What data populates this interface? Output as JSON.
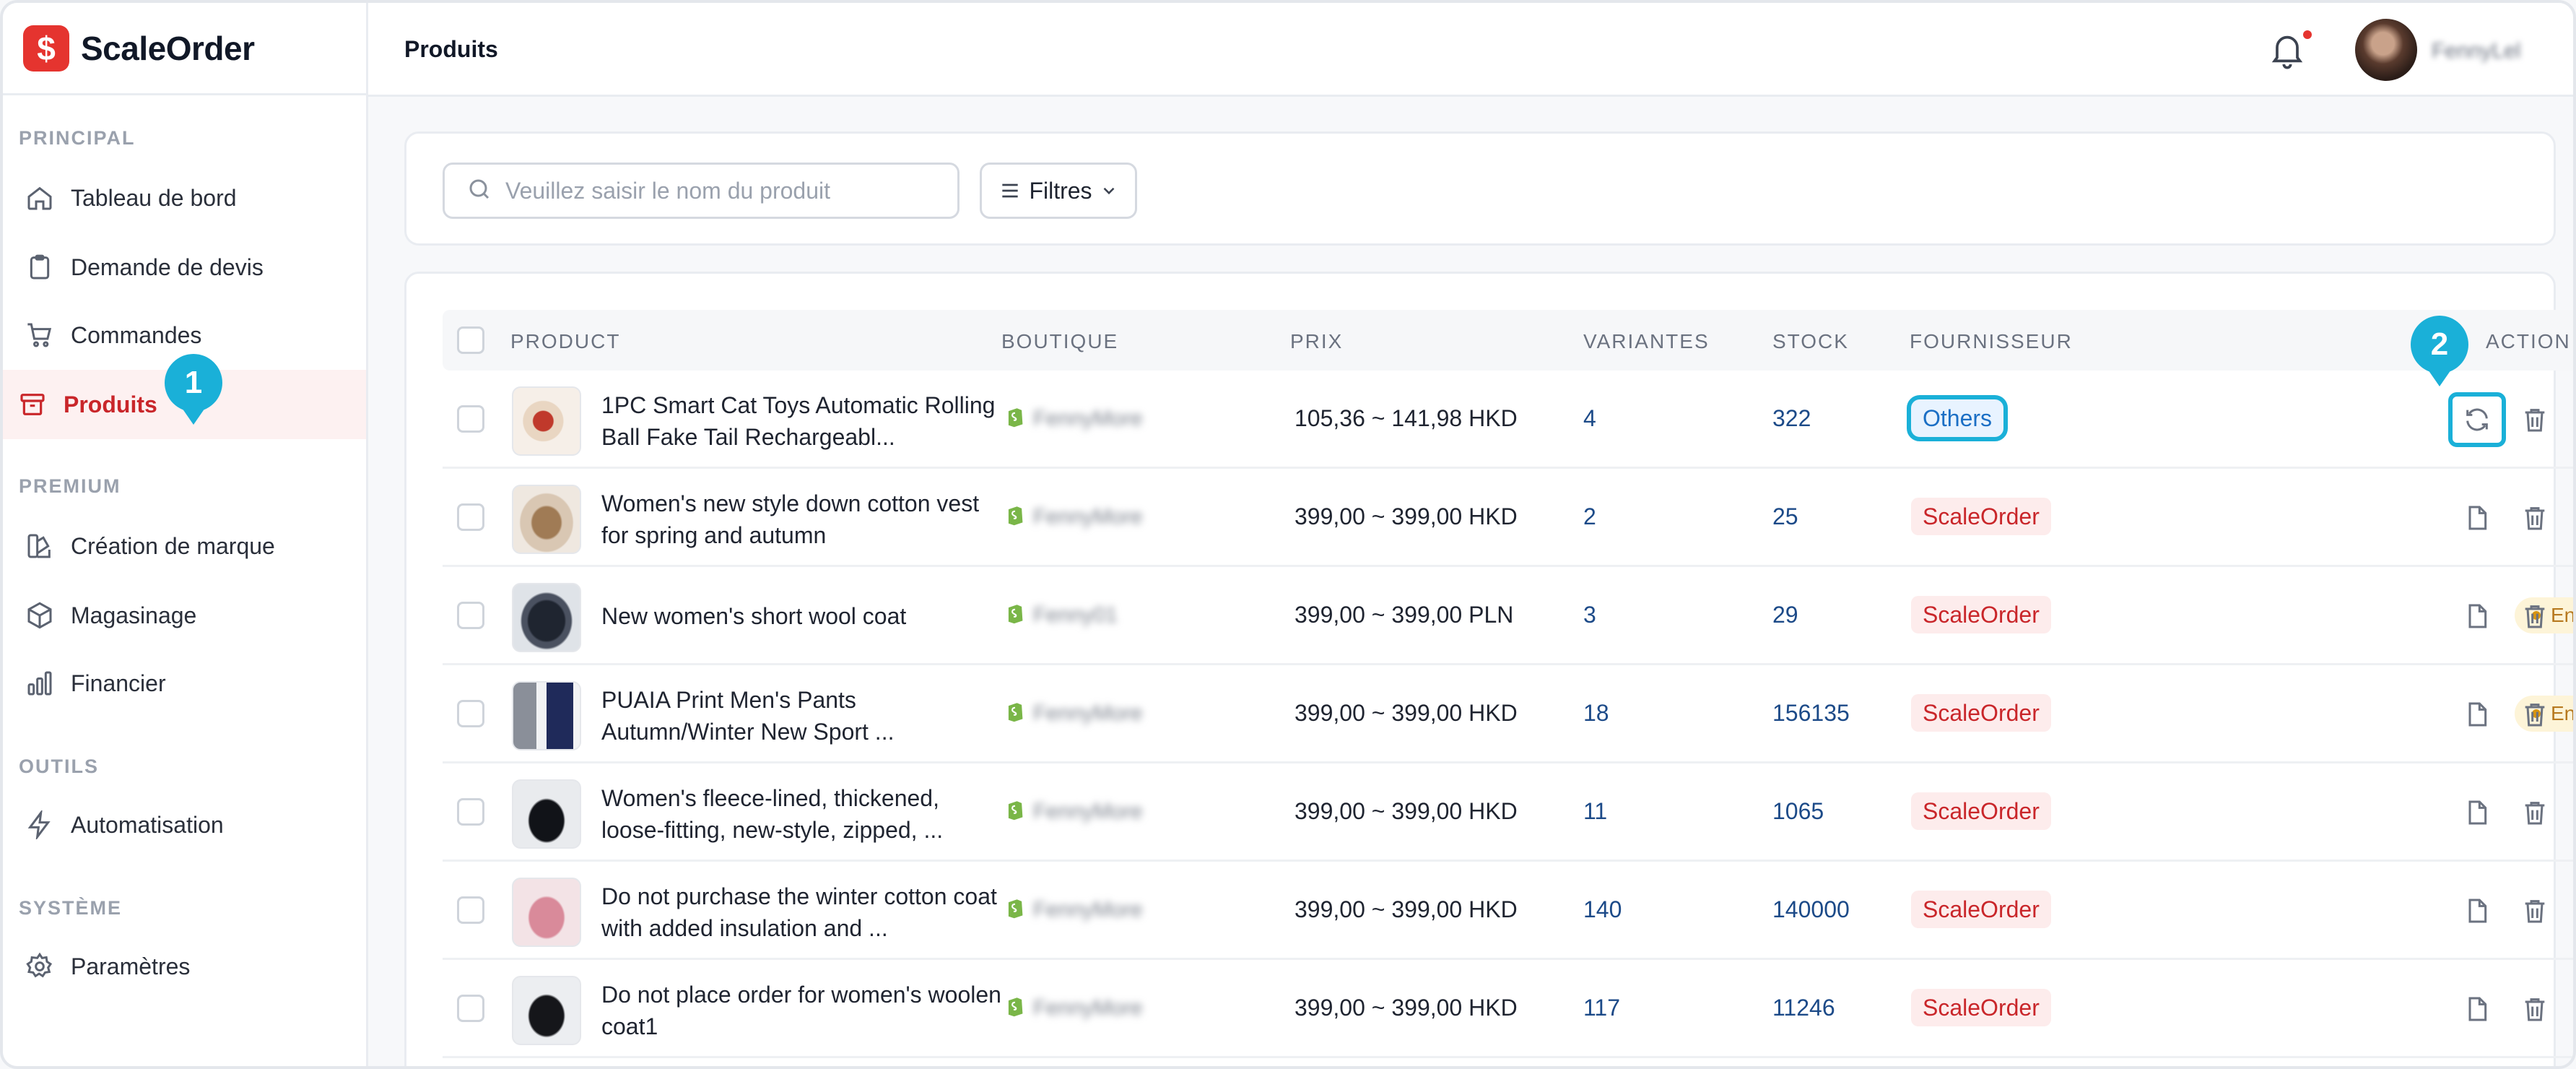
{
  "app": {
    "name": "ScaleOrder",
    "logo_glyph": "$"
  },
  "header": {
    "title": "Produits",
    "username": "FennyLel"
  },
  "sidebar": {
    "sections": [
      {
        "title": "PRINCIPAL",
        "items": [
          "Tableau de bord",
          "Demande de devis",
          "Commandes",
          "Produits"
        ]
      },
      {
        "title": "PREMIUM",
        "items": [
          "Création de marque",
          "Magasinage",
          "Financier"
        ]
      },
      {
        "title": "OUTILS",
        "items": [
          "Automatisation"
        ]
      },
      {
        "title": "SYSTÈME",
        "items": [
          "Paramètres"
        ]
      }
    ],
    "active": "Produits"
  },
  "steps": {
    "one": "1",
    "two": "2"
  },
  "search": {
    "placeholder": "Veuillez saisir le nom du produit",
    "filter_label": "Filtres"
  },
  "table": {
    "headers": {
      "product": "PRODUCT",
      "boutique": "BOUTIQUE",
      "prix": "PRIX",
      "variantes": "VARIANTES",
      "stock": "STOCK",
      "fournisseur": "FOURNISSEUR",
      "action": "ACTION"
    },
    "rows": [
      {
        "name": "1PC  Smart Cat Toys Automatic Rolling Ball Fake Tail Rechargeabl...",
        "shop": "FennyMore",
        "price": "105,36 ~ 141,98 HKD",
        "variants": "4",
        "stock": "322",
        "supplier": "Others",
        "status": ""
      },
      {
        "name": "Women's new style down cotton vest for spring and autumn",
        "shop": "FennyMore",
        "price": "399,00 ~ 399,00 HKD",
        "variants": "2",
        "stock": "25",
        "supplier": "ScaleOrder",
        "status": ""
      },
      {
        "name": "New women's short wool  coat",
        "shop": "Fenny01",
        "price": "399,00 ~ 399,00 PLN",
        "variants": "3",
        "stock": "29",
        "supplier": "ScaleOrder",
        "status": "En révision"
      },
      {
        "name": "PUAIA Print Men's Pants Autumn/Winter New Sport ...",
        "shop": "FennyMore",
        "price": "399,00 ~ 399,00 HKD",
        "variants": "18",
        "stock": "156135",
        "supplier": "ScaleOrder",
        "status": "En révision"
      },
      {
        "name": "Women's fleece-lined, thickened, loose-fitting, new-style, zipped, ...",
        "shop": "FennyMore",
        "price": "399,00 ~ 399,00 HKD",
        "variants": "11",
        "stock": "1065",
        "supplier": "ScaleOrder",
        "status": ""
      },
      {
        "name": "Do not purchase the winter cotton coat with added insulation and ...",
        "shop": "FennyMore",
        "price": "399,00 ~ 399,00 HKD",
        "variants": "140",
        "stock": "140000",
        "supplier": "ScaleOrder",
        "status": ""
      },
      {
        "name": "Do not place order for women's woolen coat1",
        "shop": "FennyMore",
        "price": "399,00 ~ 399,00 HKD",
        "variants": "117",
        "stock": "11246",
        "supplier": "ScaleOrder",
        "status": ""
      }
    ]
  },
  "colors": {
    "brand": "#e5342f",
    "highlight": "#1ab0d8",
    "link": "#1c4a88"
  }
}
